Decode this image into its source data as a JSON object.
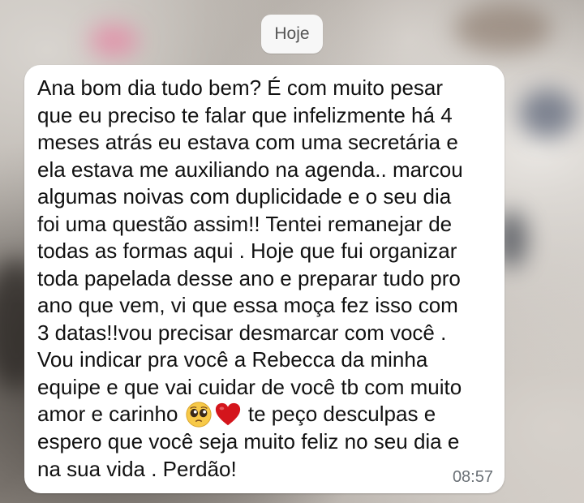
{
  "date_chip": {
    "label": "Hoje"
  },
  "message": {
    "text_part1": "Ana bom dia tudo bem? É com muito pesar\nque eu preciso te falar que infelizmente há 4\nmeses atrás eu estava com uma secretária e\nela estava me auxiliando na agenda.. marcou\nalgumas noivas com duplicidade e o seu dia\nfoi uma questão assim!! Tentei remanejar de\ntodas as formas aqui . Hoje que fui organizar\ntoda papelada desse ano e preparar tudo pro\nano que vem, vi que essa moça fez isso com\n3 datas!!vou precisar desmarcar com você .\nVou indicar pra você a Rebecca da minha\nequipe e que vai cuidar de você tb com muito\namor e carinho ",
    "emojis": [
      "pleading-face",
      "red-heart"
    ],
    "text_part2": " te peço desculpas e\nespero que você seja muito feliz no seu dia e\nna sua vida . Perdão!",
    "time": "08:57"
  },
  "colors": {
    "bubble": "#ffffff",
    "chip": "#f7f7f7",
    "timestamp": "#6b7177",
    "heart": "#d4151c"
  }
}
